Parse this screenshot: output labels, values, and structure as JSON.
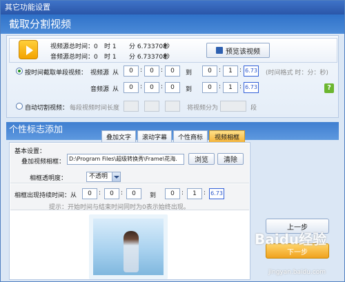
{
  "window": {
    "title": "其它功能设置"
  },
  "section1": {
    "title": "截取分割视频"
  },
  "video_info": {
    "video_total_label": "视频源总时间：0",
    "audio_total_label": "音频源总时间：0",
    "hour": "时 1",
    "minute": "分 6.733708",
    "second": "秒",
    "preview_button": "预览该视频"
  },
  "cut_by_time": {
    "radio_label": "按时间截取单段视频：",
    "video_source": "视频源",
    "audio_source": "音频源",
    "from": "从",
    "to": "到",
    "video_from": [
      "0",
      "0",
      "0"
    ],
    "video_to": [
      "0",
      "1",
      "6.73"
    ],
    "audio_from": [
      "0",
      "0",
      "0"
    ],
    "audio_to": [
      "0",
      "1",
      "6.73"
    ],
    "format_hint": "(时间格式 时：分：秒)"
  },
  "auto_cut": {
    "radio_label": "自动切割视频：",
    "segment_length_label": "每段视频时间长度",
    "split_into_label": "将视频分为",
    "segment_unit": "段"
  },
  "section2": {
    "title": "个性标志添加"
  },
  "tabs": [
    "叠加文字",
    "滚动字幕",
    "个性商标",
    "视频相框"
  ],
  "frame_panel": {
    "basic_settings": "基本设置：",
    "overlay_frame_label": "叠加视频相框：",
    "path": "D:\\Program Files\\超级转换秀\\Frame\\花海.",
    "browse": "浏览",
    "clear": "清除",
    "opacity_label": "相框透明度：",
    "opacity_value": "不透明",
    "duration_label": "相框出现持续时间：从",
    "from_values": [
      "0",
      "0",
      "0"
    ],
    "to_label": "到",
    "to_values": [
      "0",
      "1",
      "6.73"
    ],
    "tip": "提示：开始时间与结束时间同时为0表示始终出现。"
  },
  "buttons": {
    "prev": "上一步",
    "next": "下一步"
  },
  "watermark": {
    "brand": "Baidu经验",
    "url": "jingyan.baidu.com"
  }
}
